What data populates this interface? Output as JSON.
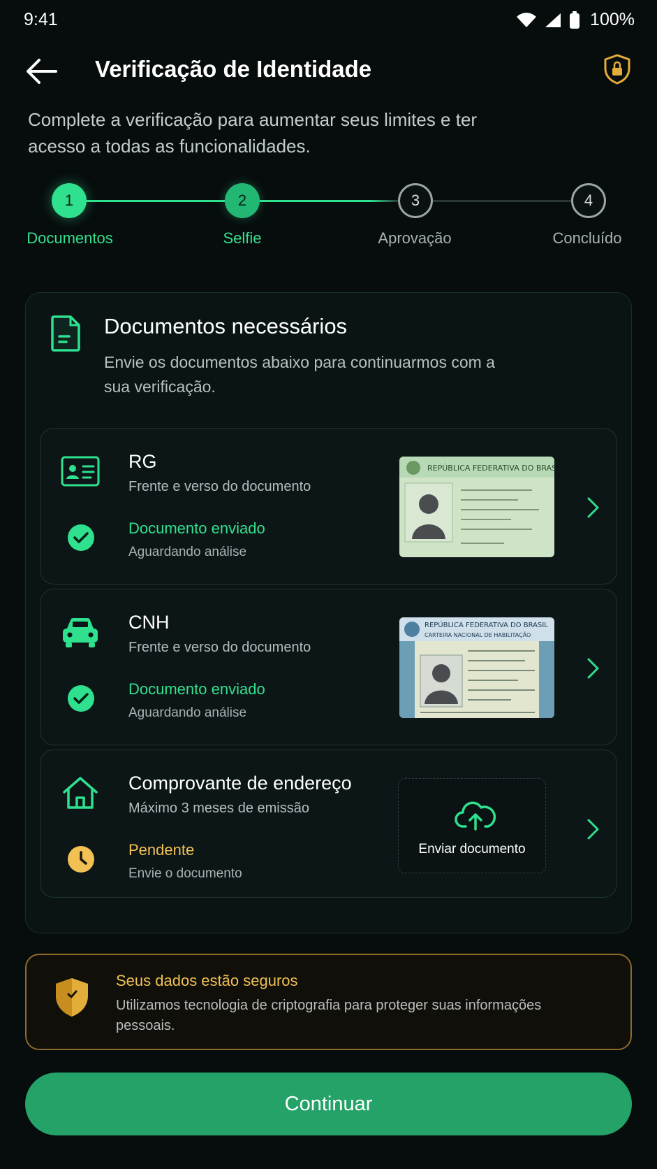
{
  "status_bar": {
    "time": "9:41",
    "battery": "100%"
  },
  "header": {
    "title": "Verificação de Identidade"
  },
  "subtitle": "Complete a verificação para aumentar seus limites e ter acesso a todas as funcionalidades.",
  "stepper": {
    "steps": [
      {
        "number": "1",
        "label": "Documentos",
        "state": "done"
      },
      {
        "number": "2",
        "label": "Selfie",
        "state": "active"
      },
      {
        "number": "3",
        "label": "Aprovação",
        "state": "todo"
      },
      {
        "number": "4",
        "label": "Concluído",
        "state": "todo"
      }
    ]
  },
  "documents_card": {
    "title": "Documentos necessários",
    "description": "Envie os documentos abaixo para continuarmos com a sua verificação.",
    "items": [
      {
        "name": "RG",
        "subtitle": "Frente e verso do documento",
        "status": "Documento enviado",
        "status_detail": "Aguardando análise",
        "icon": "id-card-icon",
        "card_header": "REPÚBLICA FEDERATIVA DO BRASIL"
      },
      {
        "name": "CNH",
        "subtitle": "Frente e verso do documento",
        "status": "Documento enviado",
        "status_detail": "Aguardando análise",
        "icon": "car-icon",
        "card_header": "REPÚBLICA FEDERATIVA DO BRASIL",
        "card_subheader": "CARTEIRA NACIONAL DE HABILITAÇÃO"
      },
      {
        "name": "Comprovante de endereço",
        "subtitle": "Máximo 3 meses de emissão",
        "status": "Pendente",
        "status_detail": "Envie o documento",
        "icon": "house-icon",
        "upload_label": "Enviar documento"
      }
    ]
  },
  "security_notice": {
    "title": "Seus dados estão seguros",
    "description": "Utilizamos tecnologia de criptografia para proteger suas informações pessoais."
  },
  "continue_button": {
    "label": "Continuar"
  },
  "colors": {
    "accent_green": "#2fe08e",
    "pending_yellow": "#f1c154",
    "background": "#070c0d",
    "button": "#24a267"
  }
}
